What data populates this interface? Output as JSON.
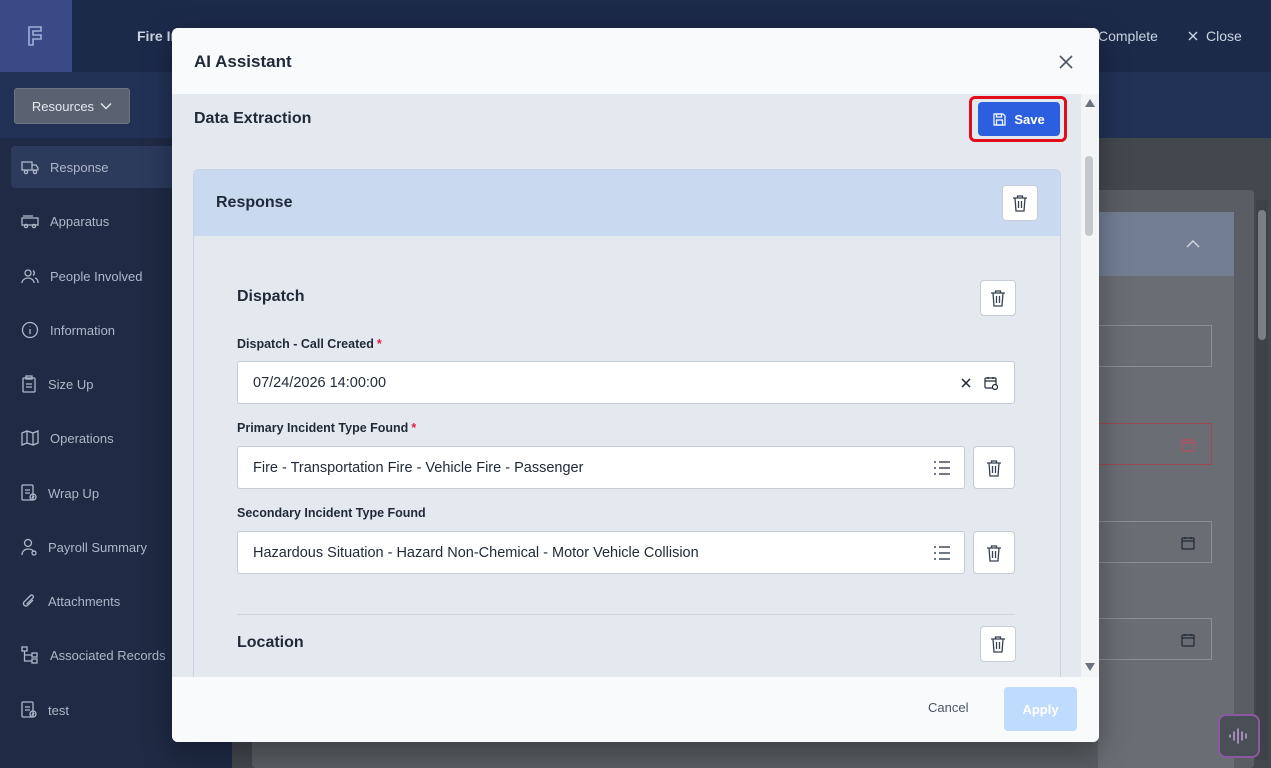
{
  "app": {
    "title_partial": "Fire In",
    "complete_label": "Complete",
    "close_label": "Close",
    "resources_label": "Resources"
  },
  "sidebar": {
    "items": [
      {
        "label": "Response",
        "icon": "truck-icon",
        "active": true
      },
      {
        "label": "Apparatus",
        "icon": "fire-engine-icon"
      },
      {
        "label": "People Involved",
        "icon": "people-icon"
      },
      {
        "label": "Information",
        "icon": "info-icon"
      },
      {
        "label": "Size Up",
        "icon": "clipboard-icon"
      },
      {
        "label": "Operations",
        "icon": "map-icon"
      },
      {
        "label": "Wrap Up",
        "icon": "checklist-icon"
      },
      {
        "label": "Payroll Summary",
        "icon": "person-badge-icon"
      },
      {
        "label": "Attachments",
        "icon": "paperclip-icon"
      },
      {
        "label": "Associated Records",
        "icon": "hierarchy-icon"
      },
      {
        "label": "test",
        "icon": "checklist-icon"
      }
    ]
  },
  "modal": {
    "title": "AI Assistant",
    "section_title": "Data Extraction",
    "save_label": "Save",
    "group_title": "Response",
    "dispatch": {
      "title": "Dispatch",
      "fields": [
        {
          "label": "Dispatch - Call Created",
          "required": "*",
          "value": "07/24/2026 14:00:00"
        },
        {
          "label": "Primary Incident Type Found",
          "required": "*",
          "value": "Fire - Transportation Fire - Vehicle Fire - Passenger"
        },
        {
          "label": "Secondary Incident Type Found",
          "required": "",
          "value": "Hazardous Situation - Hazard Non-Chemical - Motor Vehicle Collision"
        }
      ]
    },
    "location_title": "Location",
    "cancel_label": "Cancel",
    "apply_label": "Apply"
  },
  "colors": {
    "primary": "#2b5fe0",
    "highlight": "#e10e1a",
    "apply_disabled": "#bfdbfe",
    "group_header": "#c8d9f0"
  }
}
